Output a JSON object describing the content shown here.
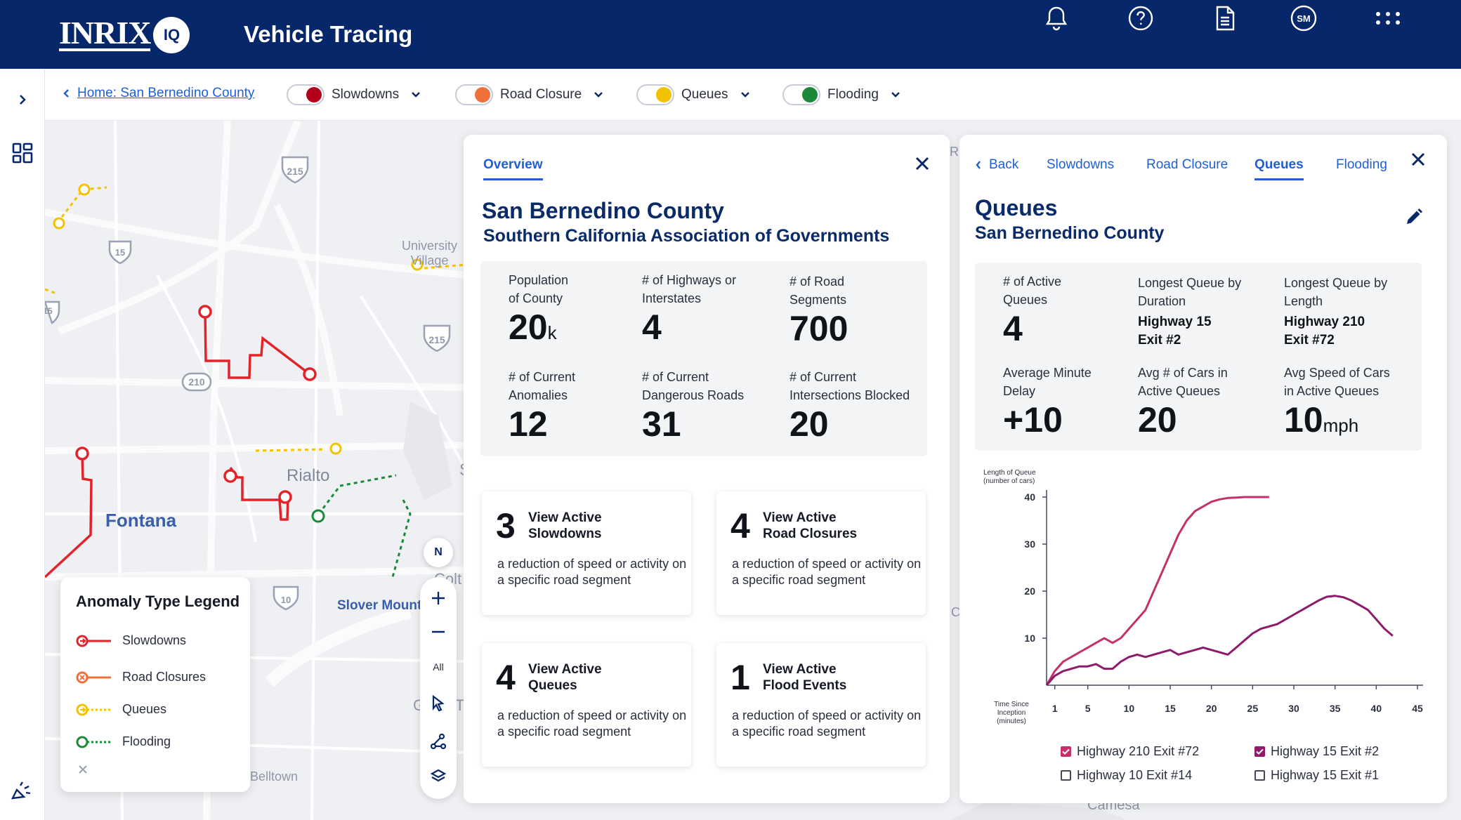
{
  "header": {
    "logo_text": "INRIX",
    "logo_badge": "IQ",
    "title": "Vehicle Tracing",
    "avatar_initials": "SM"
  },
  "filterbar": {
    "breadcrumb": "Home: San Bernedino County",
    "filters": [
      {
        "label": "Slowdowns",
        "color": "#b3001b"
      },
      {
        "label": "Road Closure",
        "color": "#f0703a"
      },
      {
        "label": "Queues",
        "color": "#f2c200"
      },
      {
        "label": "Flooding",
        "color": "#1a8a3a"
      }
    ]
  },
  "map": {
    "labels": {
      "university_village": "University\nVillage",
      "rialto": "Rialto",
      "fontana": "Fontana",
      "slover_mountain": "Slover Mounta",
      "belltown": "Belltown",
      "colt": "Colt",
      "r_frag": "Ri",
      "s_frag": "S",
      "g_frag": "G",
      "t_frag": "T",
      "cr_frag": "Cr",
      "camesa": "Camesa"
    },
    "shields": [
      "215",
      "15",
      "215",
      "210",
      "10",
      "15"
    ],
    "compass": "N",
    "controls": {
      "all_label": "All"
    }
  },
  "legend": {
    "title": "Anomaly Type Legend",
    "items": [
      {
        "label": "Slowdowns",
        "color": "#e2232a"
      },
      {
        "label": "Road Closures",
        "color": "#f0703a"
      },
      {
        "label": "Queues",
        "color": "#f2c200"
      },
      {
        "label": "Flooding",
        "color": "#1a8a3a"
      }
    ]
  },
  "overview": {
    "tab": "Overview",
    "title": "San Bernedino County",
    "subtitle": "Southern California Association of Governments",
    "stats": [
      {
        "label": "Population\nof County",
        "value": "20",
        "unit": "k"
      },
      {
        "label": "# of Highways or\nInterstates",
        "value": "4",
        "unit": ""
      },
      {
        "label": "# of Road\nSegments",
        "value": "700",
        "unit": ""
      },
      {
        "label": "# of Current\nAnomalies",
        "value": "12",
        "unit": ""
      },
      {
        "label": "# of Current\nDangerous Roads",
        "value": "31",
        "unit": ""
      },
      {
        "label": "# of Current\nIntersections Blocked",
        "value": "20",
        "unit": ""
      }
    ],
    "cards": [
      {
        "num": "3",
        "title": "View Active\nSlowdowns",
        "desc": "a reduction of speed or activity on a specific road segment"
      },
      {
        "num": "4",
        "title": "View Active\nRoad Closures",
        "desc": "a reduction of speed or activity on a specific road segment"
      },
      {
        "num": "4",
        "title": "View Active\nQueues",
        "desc": "a reduction of speed or activity on a specific road segment"
      },
      {
        "num": "1",
        "title": "View Active\nFlood Events",
        "desc": "a reduction of speed or activity on a specific road segment"
      }
    ]
  },
  "queues": {
    "tabs": [
      "Back",
      "Slowdowns",
      "Road Closure",
      "Queues",
      "Flooding"
    ],
    "active_tab": "Queues",
    "title": "Queues",
    "subtitle": "San Bernedino County",
    "stats": [
      {
        "label": "# of Active\nQueues",
        "value": "4",
        "unit": "",
        "strong": ""
      },
      {
        "label": "Longest Queue by\nDuration",
        "value": "",
        "unit": "",
        "strong": "Highway 15\nExit #2"
      },
      {
        "label": "Longest Queue by\nLength",
        "value": "",
        "unit": "",
        "strong": "Highway 210\nExit #72"
      },
      {
        "label": "Average Minute\nDelay",
        "value": "+10",
        "unit": "",
        "strong": ""
      },
      {
        "label": "Avg # of Cars in\nActive Queues",
        "value": "20",
        "unit": "",
        "strong": ""
      },
      {
        "label": "Avg Speed of Cars\nin Active Queues",
        "value": "10",
        "unit": "mph",
        "strong": ""
      }
    ]
  },
  "chart_data": {
    "type": "line",
    "ylabel": "Length of Queue\n(number of cars)",
    "xlabel": "Time Since\nInception\n(minutes)",
    "x_ticks": [
      1,
      5,
      10,
      15,
      20,
      25,
      30,
      35,
      40,
      45
    ],
    "y_ticks": [
      10,
      20,
      30,
      40
    ],
    "xlim": [
      0,
      45
    ],
    "ylim": [
      0,
      40
    ],
    "grid": false,
    "series": [
      {
        "name": "Highway 210 Exit #72",
        "color": "#c3306a",
        "checked": true,
        "x": [
          0,
          1,
          2,
          3,
          4,
          5,
          6,
          7,
          8,
          9,
          10,
          11,
          12,
          13,
          14,
          15,
          16,
          17,
          18,
          19,
          20,
          21,
          22,
          23,
          24,
          25,
          26,
          27
        ],
        "y": [
          0,
          3,
          5,
          6,
          7,
          8,
          9,
          10,
          9,
          10,
          12,
          14,
          16,
          20,
          24,
          28,
          32,
          35,
          37,
          38,
          39,
          39.5,
          39.8,
          39.9,
          40,
          40,
          40,
          40
        ]
      },
      {
        "name": "Highway 15 Exit #2",
        "color": "#8e1a6c",
        "checked": true,
        "x": [
          0,
          1,
          2,
          3,
          4,
          5,
          6,
          7,
          8,
          9,
          10,
          11,
          12,
          13,
          14,
          15,
          16,
          17,
          18,
          19,
          20,
          21,
          22,
          23,
          24,
          25,
          26,
          27,
          28,
          29,
          30,
          31,
          32,
          33,
          34,
          35,
          36,
          37,
          38,
          39,
          40,
          41,
          42
        ],
        "y": [
          0,
          2,
          3,
          3.5,
          4,
          4,
          4.5,
          3.5,
          3.5,
          5,
          6,
          6.5,
          6,
          6.5,
          7,
          7.5,
          6.5,
          7,
          7.5,
          8,
          7.5,
          7,
          6.5,
          8,
          9.5,
          11,
          12,
          12.5,
          13,
          14,
          15,
          16,
          17,
          18,
          18.8,
          19,
          18.7,
          18,
          17,
          16,
          14,
          12,
          10.5
        ]
      },
      {
        "name": "Highway 10 Exit #14",
        "color": "#444a5a",
        "checked": false,
        "x": [],
        "y": []
      },
      {
        "name": "Highway 15 Exit #1",
        "color": "#444a5a",
        "checked": false,
        "x": [],
        "y": []
      }
    ]
  }
}
